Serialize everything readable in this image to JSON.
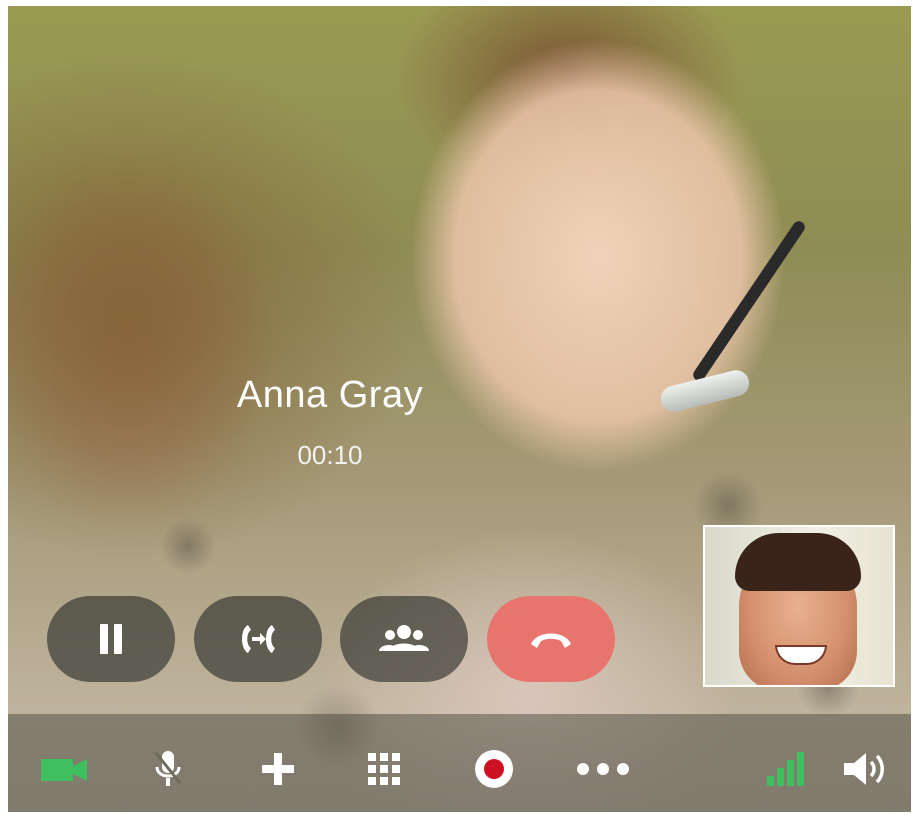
{
  "call": {
    "caller_name": "Anna Gray",
    "duration": "00:10"
  },
  "controls": [
    {
      "name": "hold-button",
      "icon": "pause-icon"
    },
    {
      "name": "transfer-button",
      "icon": "call-transfer-icon"
    },
    {
      "name": "conference-button",
      "icon": "people-icon"
    },
    {
      "name": "end-call-button",
      "icon": "hang-up-icon"
    }
  ],
  "toolbar": [
    {
      "name": "video-toggle-button",
      "icon": "video-camera-icon",
      "state": "on"
    },
    {
      "name": "mute-button",
      "icon": "microphone-muted-icon"
    },
    {
      "name": "add-call-button",
      "icon": "plus-icon"
    },
    {
      "name": "dialpad-button",
      "icon": "keypad-grid-icon"
    },
    {
      "name": "record-button",
      "icon": "record-icon"
    },
    {
      "name": "more-options-button",
      "icon": "more-dots-icon"
    },
    {
      "name": "signal-quality-indicator",
      "icon": "signal-bars-icon"
    },
    {
      "name": "speaker-volume-button",
      "icon": "speaker-icon"
    }
  ],
  "colors": {
    "hangup": "#e8756d",
    "accent_green": "#3fbf5f",
    "record_red": "#cc1122",
    "control_bg": "rgba(40,44,40,0.62)"
  }
}
